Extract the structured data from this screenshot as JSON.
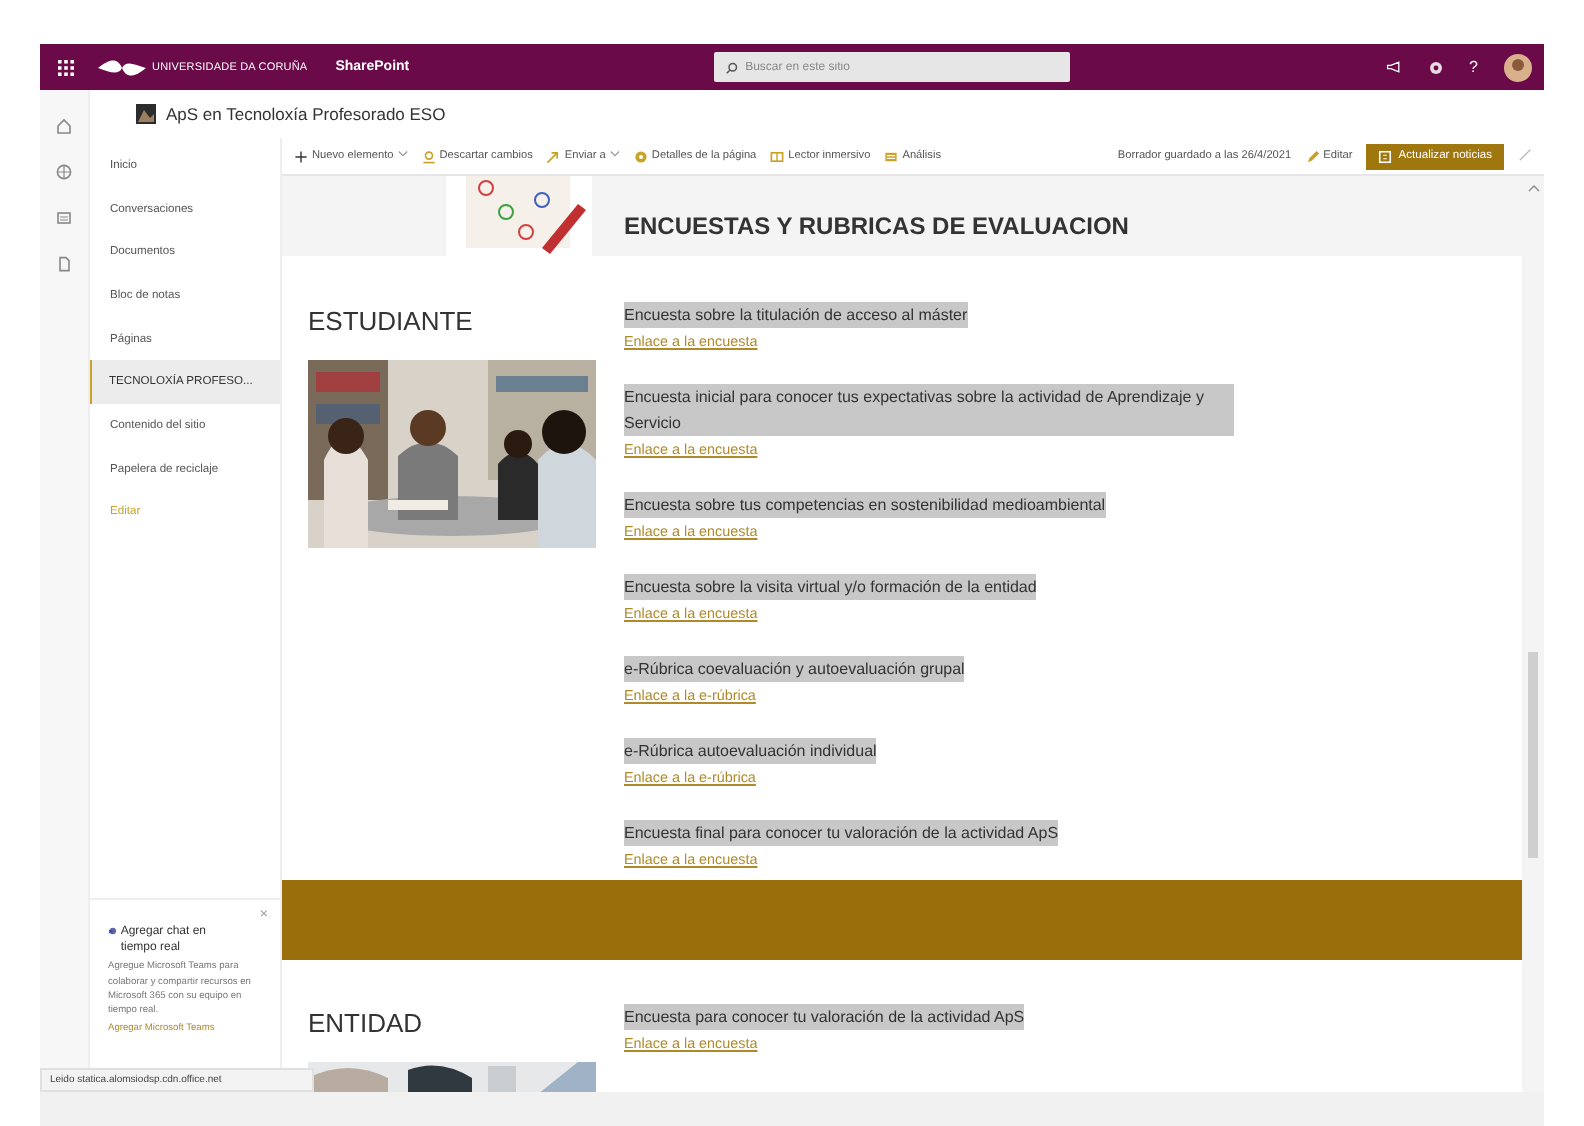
{
  "suite_bar": {
    "org": "UNIVERSIDADE DA CORUÑA",
    "app": "SharePoint",
    "search": {
      "placeholder": "Buscar en este sitio"
    },
    "help": "?"
  },
  "site": {
    "title": "ApS en Tecnoloxía Profesorado ESO"
  },
  "nav": [
    {
      "label": "Inicio",
      "kind": "link",
      "selected": false
    },
    {
      "label": "Conversaciones",
      "kind": "link",
      "selected": false
    },
    {
      "label": "Documentos",
      "kind": "link",
      "selected": false
    },
    {
      "label": "Bloc de notas",
      "kind": "link",
      "selected": false
    },
    {
      "label": "Páginas",
      "kind": "link",
      "selected": false
    },
    {
      "label": "TECNOLOXÍA PROFESO...",
      "kind": "link",
      "selected": true
    },
    {
      "label": "Contenido del sitio",
      "kind": "link",
      "selected": false
    },
    {
      "label": "Papelera de reciclaje",
      "kind": "link",
      "selected": false
    },
    {
      "label": "Editar",
      "kind": "edit",
      "selected": false
    }
  ],
  "command_bar": {
    "items": [
      {
        "label": "Nuevo elemento",
        "kind": "new",
        "dropdown": true
      },
      {
        "label": "Descartar cambios",
        "kind": "discard",
        "dropdown": false
      },
      {
        "label": "Enviar a",
        "kind": "send",
        "dropdown": true
      },
      {
        "label": "Detalles de la página",
        "kind": "details",
        "dropdown": false
      },
      {
        "label": "Lector inmersivo",
        "kind": "reader",
        "dropdown": false
      },
      {
        "label": "Análisis",
        "kind": "analytics",
        "dropdown": false
      }
    ],
    "status": "Borrador guardado a las 26/4/2021",
    "edit": "Editar",
    "publish": "Actualizar noticias"
  },
  "banner": {
    "heading": "ENCUESTAS Y RUBRICAS DE EVALUACION"
  },
  "sections": [
    {
      "heading": "ESTUDIANTE",
      "items": [
        {
          "title": "Encuesta sobre la titulación de acceso al máster",
          "link": "Enlace a la encuesta"
        },
        {
          "title": "Encuesta inicial para conocer tus expectativas sobre la actividad de Aprendizaje y Servicio",
          "link": "Enlace a la encuesta"
        },
        {
          "title": "Encuesta sobre tus competencias en sostenibilidad medioambiental",
          "link": "Enlace a la encuesta"
        },
        {
          "title": "Encuesta sobre la visita virtual y/o formación de la entidad",
          "link": "Enlace a la encuesta"
        },
        {
          "title": "e-Rúbrica coevaluación y autoevaluación grupal",
          "link": "Enlace a la e-rúbrica"
        },
        {
          "title": "e-Rúbrica autoevaluación individual",
          "link": "Enlace a la e-rúbrica"
        },
        {
          "title": "Encuesta final para conocer tu valoración de la actividad ApS",
          "link": "Enlace a la encuesta"
        }
      ]
    },
    {
      "heading": "ENTIDAD",
      "items": [
        {
          "title": "Encuesta para conocer tu valoración de la actividad ApS",
          "link": "Enlace a la encuesta"
        }
      ]
    }
  ],
  "teams_card": {
    "close": "×",
    "title": "Agregar chat en tiempo real",
    "body": "Agregue Microsoft Teams para colaborar y compartir recursos en Microsoft 365 con su equipo en tiempo real.",
    "link": "Agregar Microsoft Teams"
  },
  "status_bar": "Leido statica.alomsiodsp.cdn.office.net"
}
